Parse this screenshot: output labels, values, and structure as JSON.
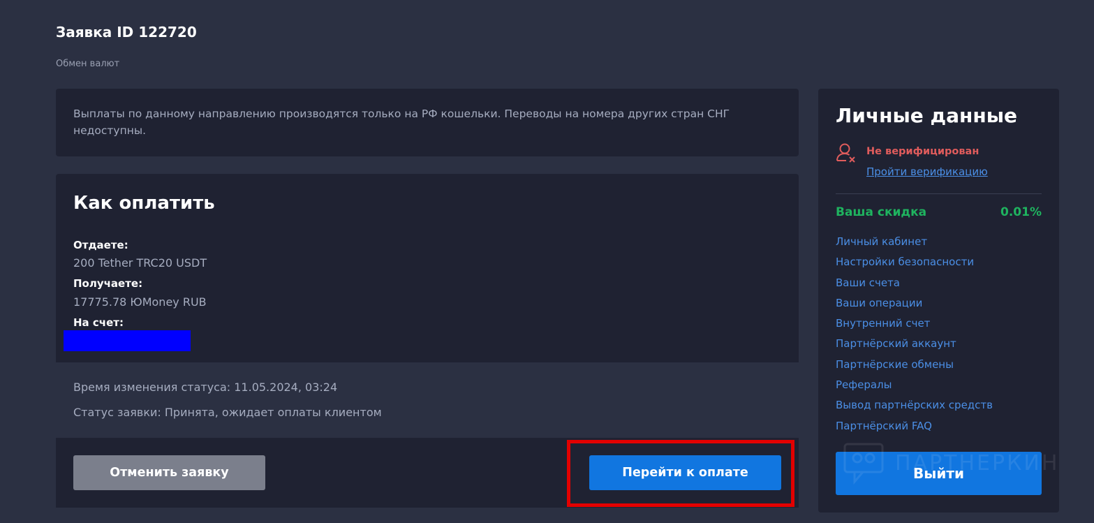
{
  "order": {
    "title": "Заявка ID 122720",
    "subtitle": "Обмен валют"
  },
  "notice": {
    "text": "Выплаты по данному направлению производятся только на РФ кошельки. Переводы на номера других стран СНГ недоступны."
  },
  "payment": {
    "title": "Как оплатить",
    "give_label": "Отдаете:",
    "give_value": "200 Tether TRC20 USDT",
    "receive_label": "Получаете:",
    "receive_value": "17775.78 ЮMoney RUB",
    "account_label": "На счет:"
  },
  "status": {
    "changed_label": "Время изменения статуса:",
    "changed_value": "11.05.2024, 03:24",
    "status_label": "Статус заявки:",
    "status_value": "Принята, ожидает оплаты клиентом"
  },
  "actions": {
    "cancel_label": "Отменить заявку",
    "pay_label": "Перейти к оплате",
    "highlight_color": "#e30000"
  },
  "sidebar": {
    "title": "Личные данные",
    "verification_icon": "user-x-icon",
    "verification_status": "Не верифицирован",
    "verification_link": "Пройти верификацию",
    "discount_label": "Ваша скидка",
    "discount_value": "0.01%",
    "menu": [
      "Личный кабинет",
      "Настройки безопасности",
      "Ваши счета",
      "Ваши операции",
      "Внутренний счет",
      "Партнёрский аккаунт",
      "Партнёрские обмены",
      "Рефералы",
      "Вывод партнёрских средств",
      "Партнёрский FAQ"
    ],
    "logout_label": "Выйти"
  },
  "watermark": {
    "text": "ПАРТНЕРКИН"
  },
  "colors": {
    "background": "#2b3042",
    "panel": "#1f2232",
    "accent_blue": "#1176e0",
    "link_blue": "#4b8fe6",
    "success_green": "#1fb35f",
    "error_red": "#e05c5c",
    "redaction": "#0000ff"
  }
}
